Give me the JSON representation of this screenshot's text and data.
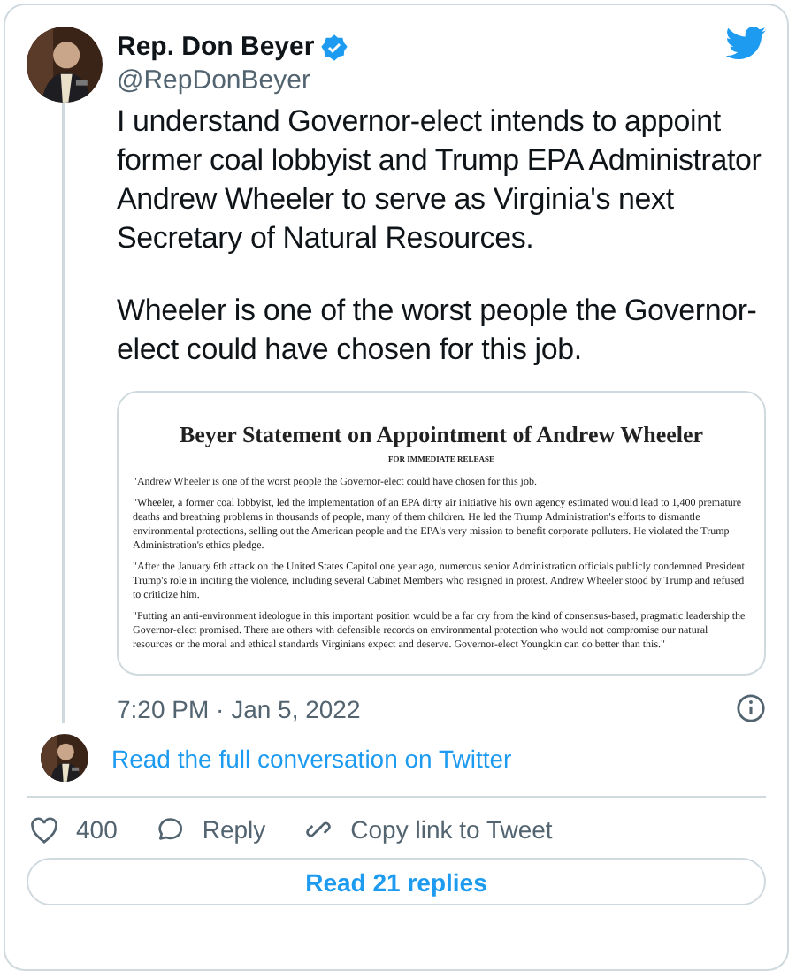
{
  "author": {
    "name": "Rep. Don Beyer",
    "handle": "@RepDonBeyer",
    "verified": true
  },
  "tweet_paragraphs": [
    "I understand Governor-elect intends to appoint former coal lobbyist and Trump EPA Administrator Andrew Wheeler to serve as Virginia's next Secretary of Natural Resources.",
    "Wheeler is one of the worst people the Governor-elect could have chosen for this job."
  ],
  "statement": {
    "title": "Beyer Statement on Appointment of Andrew Wheeler",
    "subtitle": "FOR IMMEDIATE RELEASE",
    "paragraphs": [
      "\"Andrew Wheeler is one of the worst people the Governor-elect could have chosen for this job.",
      "\"Wheeler, a former coal lobbyist, led the implementation of an EPA dirty air initiative his own agency estimated would lead to 1,400 premature deaths and breathing problems in thousands of people, many of them children. He led the Trump Administration's efforts to dismantle environmental protections, selling out the American people and the EPA's very mission to benefit corporate polluters. He violated the Trump Administration's ethics pledge.",
      "\"After the January 6th attack on the United States Capitol one year ago, numerous senior Administration officials publicly condemned President Trump's role in inciting the violence, including several Cabinet Members who resigned in protest. Andrew Wheeler stood by Trump and refused to criticize him.",
      "\"Putting an anti-environment ideologue in this important position would be a far cry from the kind of consensus-based, pragmatic leadership the Governor-elect promised. There are others with defensible records on environmental protection who would not compromise our natural resources or the moral and ethical standards Virginians expect and deserve. Governor-elect Youngkin can do better than this.\""
    ]
  },
  "timestamp": "7:20 PM · Jan 5, 2022",
  "conversation_link": "Read the full conversation on Twitter",
  "actions": [
    {
      "kind": "like",
      "label": "400"
    },
    {
      "kind": "reply",
      "label": "Reply"
    },
    {
      "kind": "copy",
      "label": "Copy link to Tweet"
    }
  ],
  "replies_button": "Read 21 replies"
}
